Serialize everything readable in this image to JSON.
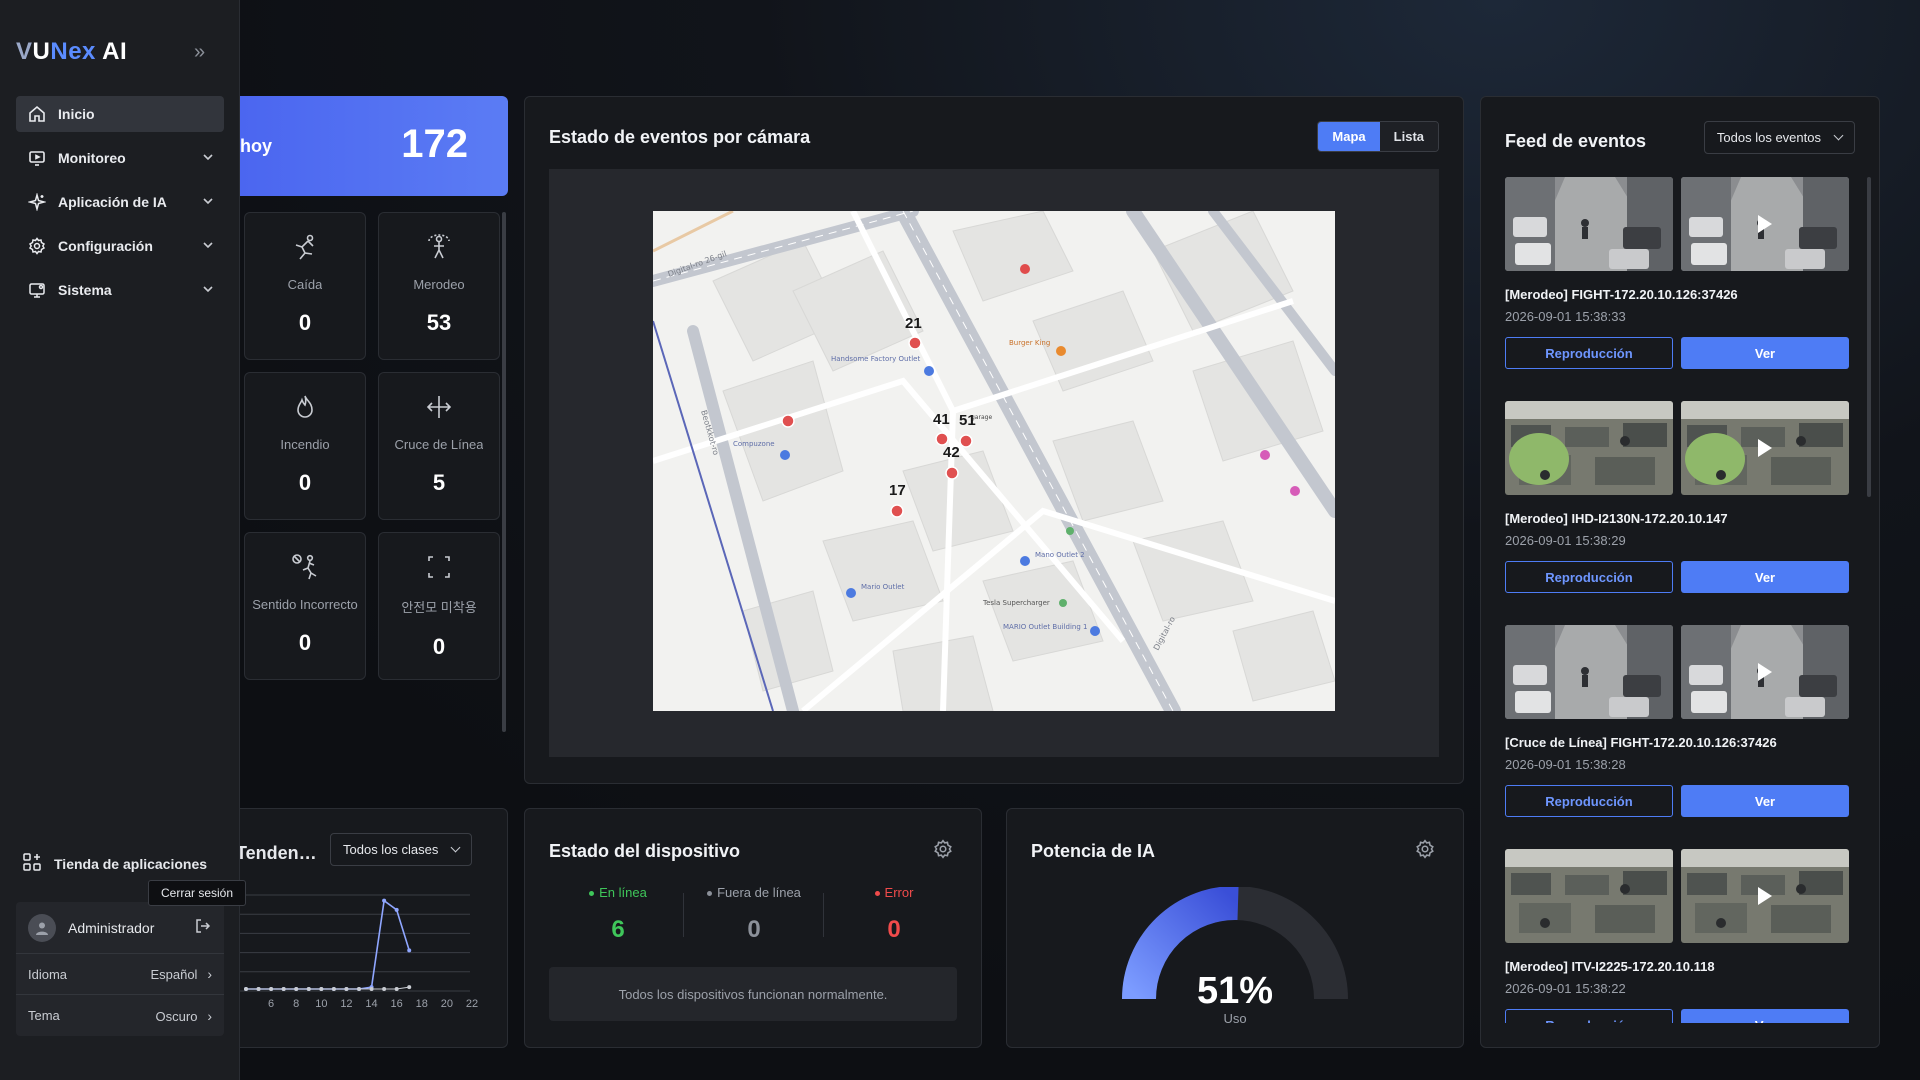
{
  "app": {
    "logo_v": "V",
    "logo_u": "U",
    "logo_nex": "Nex",
    "logo_ai": " AI"
  },
  "sidebar": {
    "items": [
      {
        "label": "Inicio",
        "icon": "home-icon"
      },
      {
        "label": "Monitoreo",
        "icon": "monitor-icon"
      },
      {
        "label": "Aplicación de IA",
        "icon": "sparkle-icon"
      },
      {
        "label": "Configuración",
        "icon": "gear-icon"
      },
      {
        "label": "Sistema",
        "icon": "system-icon"
      }
    ],
    "store_label": "Tienda de aplicaciones",
    "logout_tooltip": "Cerrar sesión",
    "user_name": "Administrador",
    "language_label": "Idioma",
    "language_value": "Español",
    "theme_label": "Tema",
    "theme_value": "Oscuro"
  },
  "today": {
    "label": "hoy",
    "total": "172",
    "stats": [
      {
        "label": "Caída",
        "value": "0",
        "icon": "fall-icon"
      },
      {
        "label": "Merodeo",
        "value": "53",
        "icon": "loitering-icon"
      },
      {
        "label": "Incendio",
        "value": "0",
        "icon": "fire-icon"
      },
      {
        "label": "Cruce de Línea",
        "value": "5",
        "icon": "line-cross-icon"
      },
      {
        "label": "Sentido Incorrecto",
        "value": "0",
        "icon": "wrong-way-icon"
      },
      {
        "label": "안전모 미착용",
        "value": "0",
        "icon": "helmet-icon"
      }
    ]
  },
  "map_panel": {
    "title": "Estado de eventos por cámara",
    "toggle_map": "Mapa",
    "toggle_list": "Lista",
    "markers": [
      {
        "label": "21"
      },
      {
        "label": "41"
      },
      {
        "label": "51"
      },
      {
        "label": "42"
      },
      {
        "label": "17"
      }
    ],
    "map_labels": [
      "Handsome Factory Outlet",
      "Compuzone",
      "Burger King",
      "Mario Outlet",
      "Mano Outlet 2",
      "Tesla Supercharger",
      "MARIO Outlet Building 1",
      "Digital-ro",
      "Beotkkot-ro",
      "Digital-ro 26-gil",
      "garage"
    ]
  },
  "detection": {
    "title": "Tendencia de detección",
    "filter": "Todos los clases"
  },
  "chart_data": {
    "type": "line",
    "x": [
      4,
      5,
      6,
      7,
      8,
      9,
      10,
      11,
      12,
      13,
      14,
      15,
      16,
      17
    ],
    "x_ticks": [
      "6",
      "8",
      "10",
      "12",
      "14",
      "16",
      "18",
      "20",
      "22"
    ],
    "series": [
      {
        "values": [
          0,
          0,
          0,
          0,
          0,
          0,
          0,
          0,
          0,
          0,
          1,
          48,
          43,
          21
        ]
      },
      {
        "values": [
          0,
          0,
          0,
          0,
          0,
          0,
          0,
          0,
          0,
          0,
          0,
          0,
          0,
          1
        ]
      }
    ],
    "ylim": [
      0,
      50
    ],
    "grid": true
  },
  "device": {
    "title": "Estado del dispositivo",
    "online_label": "En línea",
    "online_value": "6",
    "offline_label": "Fuera de línea",
    "offline_value": "0",
    "error_label": "Error",
    "error_value": "0",
    "message": "Todos los dispositivos funcionan normalmente.",
    "colors": {
      "online": "#3fc65a",
      "offline": "#8b9099",
      "error": "#f04b4b"
    }
  },
  "ai_power": {
    "title": "Potencia de IA",
    "percent": 51,
    "percent_label": "51%",
    "usage_label": "Uso"
  },
  "feed": {
    "title": "Feed de eventos",
    "filter": "Todos los eventos",
    "replay_label": "Reproducción",
    "view_label": "Ver",
    "items": [
      {
        "title": "[Merodeo] FIGHT-172.20.10.126:37426",
        "time": "2026-09-01 15:38:33",
        "scene": "street"
      },
      {
        "title": "[Merodeo] IHD-I2130N-172.20.10.147",
        "time": "2026-09-01 15:38:29",
        "scene": "office"
      },
      {
        "title": "[Cruce de Línea] FIGHT-172.20.10.126:37426",
        "time": "2026-09-01 15:38:28",
        "scene": "street"
      },
      {
        "title": "[Merodeo] ITV-I2225-172.20.10.118",
        "time": "2026-09-01 15:38:22",
        "scene": "office2"
      }
    ]
  }
}
